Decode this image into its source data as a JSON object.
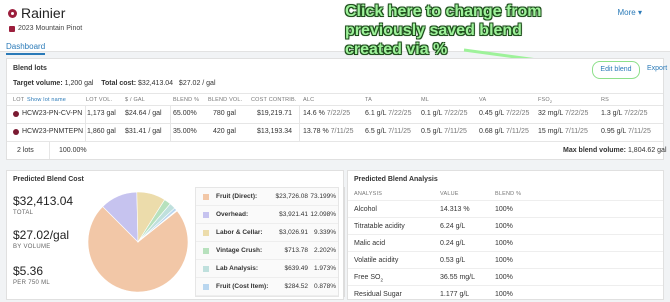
{
  "header": {
    "title": "Rainier",
    "more_label": "More",
    "subtitle": "2023 Mountain Pinot",
    "tab": "Dashboard"
  },
  "annotation": {
    "line1": "Click here to change from",
    "line2": "previously saved blend",
    "line3": "created via %",
    "color": "#9ef29a"
  },
  "blend_lots": {
    "title": "Blend lots",
    "edit_blend_label": "Edit blend",
    "export_label": "Export",
    "target_volume_label": "Target volume:",
    "target_volume_value": "1,200 gal",
    "total_cost_label": "Total cost:",
    "total_cost_value": "$32,413.04",
    "cost_per_gal_value": "$27.02 / gal",
    "columns": {
      "lot": "LOT",
      "show_lot_name": "Show lot name",
      "lot_vol": "LOT VOL.",
      "per_gal": "$ / GAL",
      "blend_pct": "BLEND %",
      "blend_vol": "BLEND VOL.",
      "cost_contrib": "COST CONTRIB.",
      "alc": "ALC",
      "ta": "TA",
      "ml": "ML",
      "va": "VA",
      "fso2": "FSO",
      "fso2_sub": "2",
      "rs": "RS"
    },
    "rows": [
      {
        "lot": "HCW23-PN-CV-PN",
        "lot_vol": "1,173 gal",
        "per_gal": "$24.64 / gal",
        "blend_pct": "65.00%",
        "blend_vol": "780 gal",
        "cost_contrib": "$19,219.71",
        "alc": "14.6 %",
        "alc_date": "7/22/25",
        "ta": "6.1 g/L",
        "ta_date": "7/22/25",
        "ml": "0.1 g/L",
        "ml_date": "7/22/25",
        "va": "0.45 g/L",
        "va_date": "7/22/25",
        "fso2": "32 mg/L",
        "fso2_date": "7/22/25",
        "rs": "1.3 g/L",
        "rs_date": "7/22/25"
      },
      {
        "lot": "HCW23-PNMTEPN",
        "lot_vol": "1,860 gal",
        "per_gal": "$31.41 / gal",
        "blend_pct": "35.00%",
        "blend_vol": "420 gal",
        "cost_contrib": "$13,193.34",
        "alc": "13.78 %",
        "alc_date": "7/11/25",
        "ta": "6.5 g/L",
        "ta_date": "7/11/25",
        "ml": "0.5 g/L",
        "ml_date": "7/11/25",
        "va": "0.68 g/L",
        "va_date": "7/11/25",
        "fso2": "15 mg/L",
        "fso2_date": "7/11/25",
        "rs": "0.95 g/L",
        "rs_date": "7/11/25"
      }
    ],
    "footer_lots": "2 lots",
    "footer_pct": "100.00%",
    "max_blend_label": "Max blend volume:",
    "max_blend_value": "1,804.62 gal"
  },
  "cost": {
    "title": "Predicted Blend Cost",
    "total_value": "$32,413.04",
    "total_label": "TOTAL",
    "per_gal_value": "$27.02/gal",
    "per_gal_label": "BY VOLUME",
    "per_bottle_value": "$5.36",
    "per_bottle_label": "PER 750 ML",
    "legend": [
      {
        "name": "Fruit (Direct):",
        "amount": "$23,726.08",
        "pct": "73.199%",
        "color": "#f2c7a7"
      },
      {
        "name": "Overhead:",
        "amount": "$3,921.41",
        "pct": "12.098%",
        "color": "#c6c3ef"
      },
      {
        "name": "Labor & Cellar:",
        "amount": "$3,026.91",
        "pct": "9.339%",
        "color": "#ecdcab"
      },
      {
        "name": "Vintage Crush:",
        "amount": "$713.78",
        "pct": "2.202%",
        "color": "#b7e1bd"
      },
      {
        "name": "Lab Analysis:",
        "amount": "$639.49",
        "pct": "1.973%",
        "color": "#bfe0dd"
      },
      {
        "name": "Fruit (Cost Item):",
        "amount": "$284.52",
        "pct": "0.878%",
        "color": "#b9d6ef"
      }
    ]
  },
  "analysis": {
    "title": "Predicted Blend Analysis",
    "columns": {
      "analysis": "ANALYSIS",
      "value": "VALUE",
      "blend": "BLEND %"
    },
    "rows": [
      {
        "name": "Alcohol",
        "sub": "",
        "value": "14.313 %",
        "blend": "100%"
      },
      {
        "name": "Titratable acidity",
        "sub": "",
        "value": "6.24 g/L",
        "blend": "100%"
      },
      {
        "name": "Malic acid",
        "sub": "",
        "value": "0.24 g/L",
        "blend": "100%"
      },
      {
        "name": "Volatile acidity",
        "sub": "",
        "value": "0.53 g/L",
        "blend": "100%"
      },
      {
        "name": "Free SO",
        "sub": "2",
        "value": "36.55 mg/L",
        "blend": "100%"
      },
      {
        "name": "Residual Sugar",
        "sub": "",
        "value": "1.177 g/L",
        "blend": "100%"
      }
    ]
  }
}
